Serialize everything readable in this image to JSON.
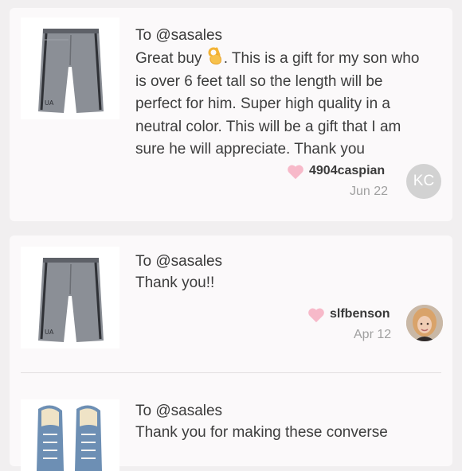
{
  "reviews": [
    {
      "to": "To @sasales",
      "text_before": "Great buy",
      "emoji_icon": "ok-hand-icon",
      "text_after": ". This is a gift for my son who is over 6 feet tall so the length will be perfect for him. Super high quality in a neutral color. This will be a gift that I am sure he will appreciate. Thank you",
      "username": "4904caspian",
      "date": "Jun 22",
      "avatar_initials": "KC",
      "product_icon": "gray-shorts-icon"
    },
    {
      "to": "To @sasales",
      "text": "Thank you!!",
      "username": "slfbenson",
      "date": "Apr 12",
      "avatar_icon": "user-photo-avatar",
      "product_icon": "gray-shorts-icon"
    },
    {
      "to": "To @sasales",
      "text": "Thank you for making these converse",
      "product_icon": "blue-sneakers-icon"
    }
  ],
  "colors": {
    "heart": "#f7b9c9",
    "background": "#f1eff0",
    "card": "#fbf9fa",
    "avatar_gray": "#d2d2d2"
  }
}
